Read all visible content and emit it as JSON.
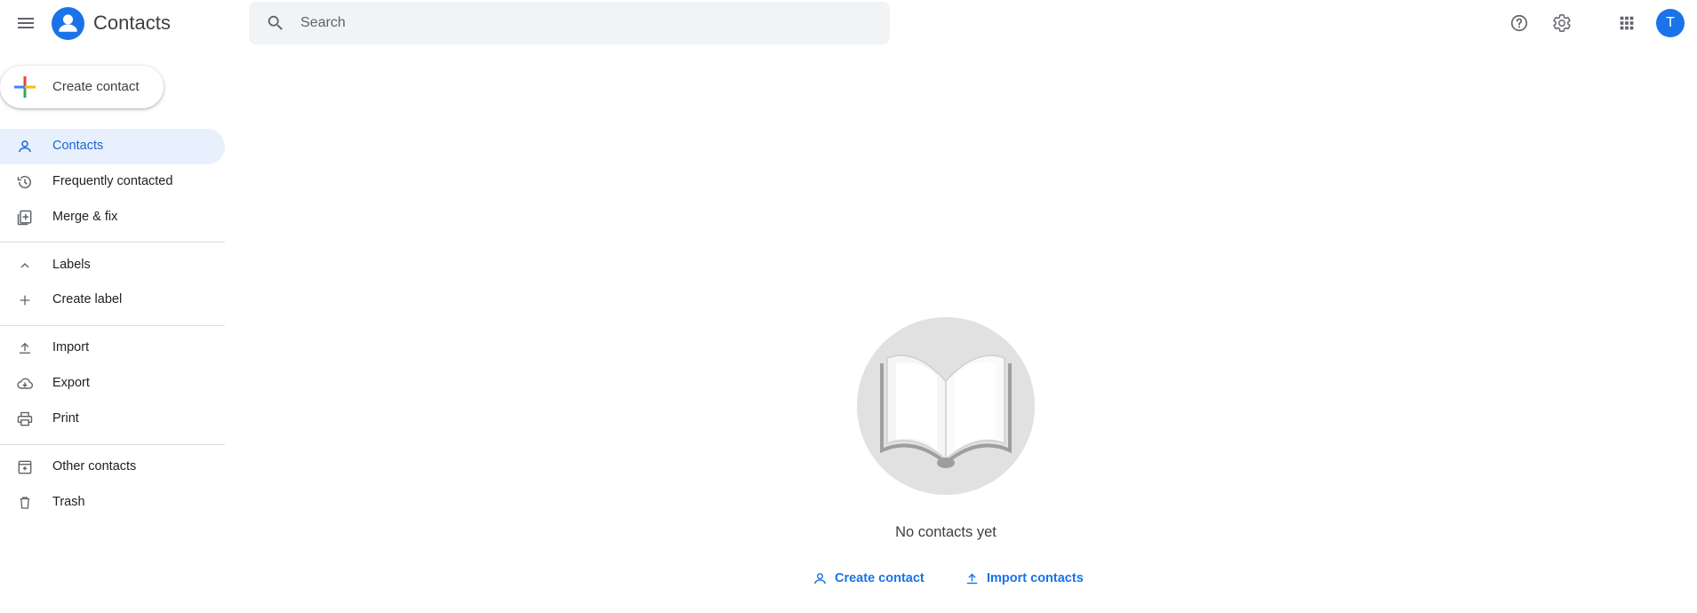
{
  "header": {
    "app_title": "Contacts",
    "search_placeholder": "Search",
    "avatar_initial": "T",
    "icons": [
      "menu-icon",
      "contacts-logo-icon",
      "search-icon",
      "help-icon",
      "gear-icon",
      "apps-icon"
    ]
  },
  "sidebar": {
    "create_label": "Create contact",
    "items": [
      {
        "label": "Contacts",
        "icon": "person-icon",
        "active": true
      },
      {
        "label": "Frequently contacted",
        "icon": "history-icon"
      },
      {
        "label": "Merge & fix",
        "icon": "merge-icon"
      },
      {
        "label": "Labels",
        "icon": "chevron-up-icon"
      },
      {
        "label": "Create label",
        "icon": "plus-icon"
      },
      {
        "label": "Import",
        "icon": "upload-icon"
      },
      {
        "label": "Export",
        "icon": "cloud-download-icon"
      },
      {
        "label": "Print",
        "icon": "print-icon"
      },
      {
        "label": "Other contacts",
        "icon": "archive-icon"
      },
      {
        "label": "Trash",
        "icon": "trash-icon"
      }
    ]
  },
  "main": {
    "empty_text": "No contacts yet",
    "create_contact_label": "Create contact",
    "import_contacts_label": "Import contacts"
  },
  "colors": {
    "accent": "#1a73e8",
    "active_bg": "#e8f0fe",
    "search_bg": "#f1f3f4",
    "avatar_bg": "#1a73e8"
  }
}
